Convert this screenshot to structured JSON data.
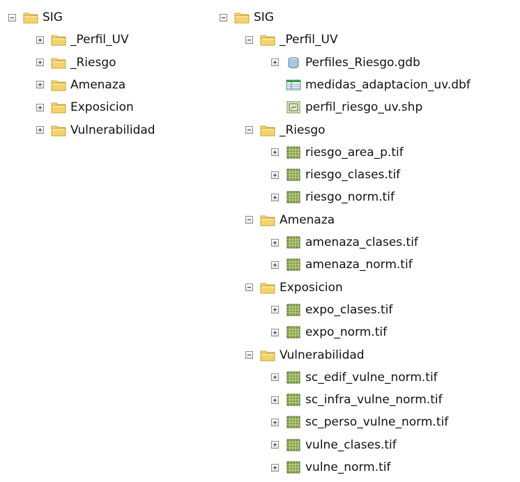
{
  "left_tree": {
    "root": {
      "label": "SIG",
      "icon": "folder-icon",
      "expanded": true
    },
    "children": [
      {
        "label": "_Perfil_UV",
        "icon": "folder-icon",
        "expanded": false
      },
      {
        "label": "_Riesgo",
        "icon": "folder-icon",
        "expanded": false
      },
      {
        "label": "Amenaza",
        "icon": "folder-icon",
        "expanded": false
      },
      {
        "label": "Exposicion",
        "icon": "folder-icon",
        "expanded": false
      },
      {
        "label": "Vulnerabilidad",
        "icon": "folder-icon",
        "expanded": false
      }
    ]
  },
  "right_tree": {
    "root": {
      "label": "SIG",
      "icon": "folder-icon",
      "expanded": true
    },
    "folders": [
      {
        "label": "_Perfil_UV",
        "icon": "folder-icon",
        "expanded": true,
        "items": [
          {
            "label": "Perfiles_Riesgo.gdb",
            "icon": "geodatabase-icon",
            "expandable": true
          },
          {
            "label": "medidas_adaptacion_uv.dbf",
            "icon": "table-icon",
            "expandable": false
          },
          {
            "label": "perfil_riesgo_uv.shp",
            "icon": "shapefile-icon",
            "expandable": false
          }
        ]
      },
      {
        "label": "_Riesgo",
        "icon": "folder-icon",
        "expanded": true,
        "items": [
          {
            "label": "riesgo_area_p.tif",
            "icon": "raster-icon",
            "expandable": true
          },
          {
            "label": "riesgo_clases.tif",
            "icon": "raster-icon",
            "expandable": true
          },
          {
            "label": "riesgo_norm.tif",
            "icon": "raster-icon",
            "expandable": true
          }
        ]
      },
      {
        "label": "Amenaza",
        "icon": "folder-icon",
        "expanded": true,
        "items": [
          {
            "label": "amenaza_clases.tif",
            "icon": "raster-icon",
            "expandable": true
          },
          {
            "label": "amenaza_norm.tif",
            "icon": "raster-icon",
            "expandable": true
          }
        ]
      },
      {
        "label": "Exposicion",
        "icon": "folder-icon",
        "expanded": true,
        "items": [
          {
            "label": "expo_clases.tif",
            "icon": "raster-icon",
            "expandable": true
          },
          {
            "label": "expo_norm.tif",
            "icon": "raster-icon",
            "expandable": true
          }
        ]
      },
      {
        "label": "Vulnerabilidad",
        "icon": "folder-icon",
        "expanded": true,
        "items": [
          {
            "label": "sc_edif_vulne_norm.tif",
            "icon": "raster-icon",
            "expandable": true
          },
          {
            "label": "sc_infra_vulne_norm.tif",
            "icon": "raster-icon",
            "expandable": true
          },
          {
            "label": "sc_perso_vulne_norm.tif",
            "icon": "raster-icon",
            "expandable": true
          },
          {
            "label": "vulne_clases.tif",
            "icon": "raster-icon",
            "expandable": true
          },
          {
            "label": "vulne_norm.tif",
            "icon": "raster-icon",
            "expandable": true
          }
        ]
      }
    ]
  },
  "colors": {
    "folder": "#f3d36b",
    "folder_edge": "#c9a33a",
    "raster": "#6f8a3a",
    "table_header": "#2e9a3a",
    "db": "#7aa3c8"
  }
}
